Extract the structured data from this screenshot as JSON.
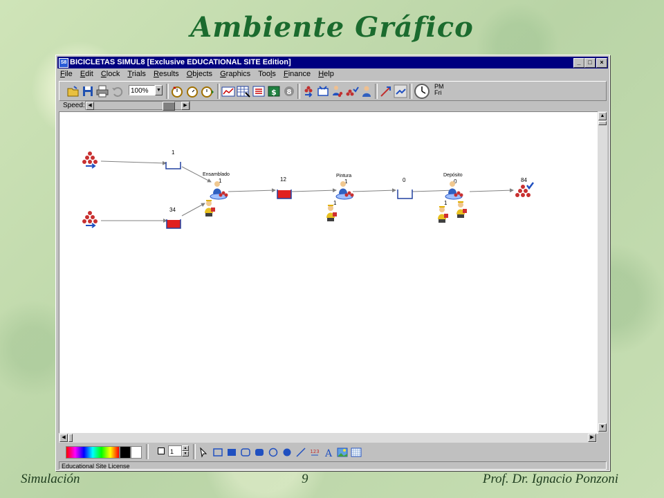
{
  "slide": {
    "title": "Ambiente Gráfico",
    "footer_left": "Simulación",
    "footer_center": "9",
    "footer_right": "Prof. Dr. Ignacio Ponzoni"
  },
  "window": {
    "title": "BICICLETAS   SIMUL8 [Exclusive EDUCATIONAL SITE Edition]",
    "icon_text": "S8",
    "minimize": "_",
    "maximize": "□",
    "close": "×"
  },
  "menu": [
    {
      "pre": "",
      "key": "F",
      "post": "ile"
    },
    {
      "pre": "",
      "key": "E",
      "post": "dit"
    },
    {
      "pre": "",
      "key": "C",
      "post": "lock"
    },
    {
      "pre": "",
      "key": "T",
      "post": "rials"
    },
    {
      "pre": "",
      "key": "R",
      "post": "esults"
    },
    {
      "pre": "",
      "key": "O",
      "post": "bjects"
    },
    {
      "pre": "",
      "key": "G",
      "post": "raphics"
    },
    {
      "pre": "Too",
      "key": "l",
      "post": "s"
    },
    {
      "pre": "",
      "key": "F",
      "post": "inance"
    },
    {
      "pre": "",
      "key": "H",
      "post": "elp"
    }
  ],
  "toolbar": {
    "zoom": "100%",
    "clock_period": "PM",
    "clock_day": "Fri"
  },
  "speedbar": {
    "label": "Speed:",
    "level": 0.9
  },
  "statusbar": {
    "text": "Educational Site License"
  },
  "drawbar": {
    "line_width": "1"
  },
  "model": {
    "queue1_count": "1",
    "queue2_count": "34",
    "ensamblado_label": "Ensamblado",
    "ensamblado_count": "1",
    "queue3_count": "12",
    "pintura_label": "Pintura",
    "pintura_count": "1",
    "pintura_resource_count": "1",
    "queue4_count": "0",
    "deposito_label": "Depósito",
    "deposito_count": "0",
    "deposito_resource_count": "1",
    "exit_count": "84"
  }
}
